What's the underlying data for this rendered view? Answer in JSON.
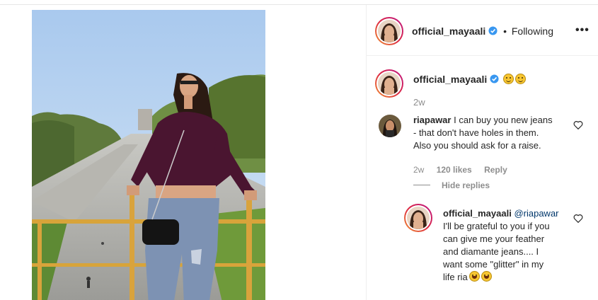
{
  "post": {
    "author": "official_mayaali",
    "follow_separator": "•",
    "follow_status": "Following",
    "more_label": "•••",
    "caption_time": "2w"
  },
  "comments": [
    {
      "user": "riapawar",
      "text_lines": [
        "I can buy you new jeans",
        "- that don't have holes in them.",
        "Also you should ask for a raise."
      ],
      "time": "2w",
      "likes": "120 likes",
      "reply_label": "Reply",
      "hide_replies": "Hide replies"
    }
  ],
  "reply": {
    "user": "official_mayaali",
    "mention": "@riapawar",
    "text_lines": [
      "I'll be grateful to you if you",
      "can give me your feather",
      "and diamante jeans.... I",
      "want some \"glitter\" in my",
      "life ria"
    ]
  },
  "colors": {
    "verified": "#3897f0",
    "ring_start": "#f09433",
    "ring_end": "#bc1888",
    "muted": "#8e8e8e"
  },
  "icons": [
    "verified-badge-icon",
    "more-options-icon",
    "heart-icon",
    "smile-emoji-icon",
    "laughing-emoji-icon"
  ]
}
